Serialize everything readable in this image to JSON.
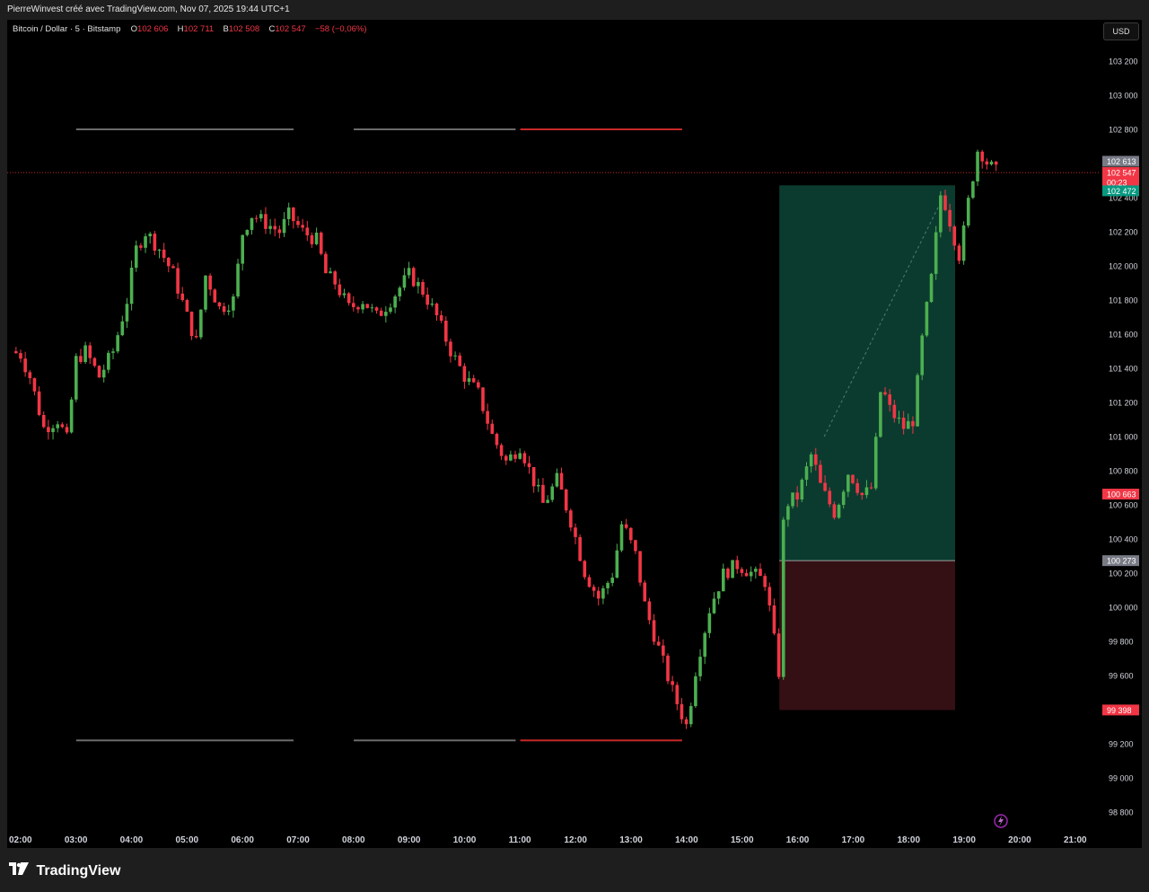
{
  "attribution": "PierreWinvest créé avec TradingView.com, Nov 07, 2025 19:44 UTC+1",
  "legend": {
    "symbol": "Bitcoin / Dollar · 5 · Bitstamp",
    "o_label": "O",
    "o_value": "102 606",
    "h_label": "H",
    "h_value": "102 711",
    "b_label": "B",
    "b_value": "102 508",
    "c_label": "C",
    "c_value": "102 547",
    "change": "−58 (−0,06%)"
  },
  "currency_button": "USD",
  "brand": "TradingView",
  "colors": {
    "up": "#26a69a",
    "up_candle": "#4caf50",
    "down": "#f23645",
    "profit_zone": "#0b3b2f",
    "loss_zone": "#341015",
    "level_gray": "#6b6b6b",
    "level_red": "#c62828",
    "background": "#000000"
  },
  "chart_data": {
    "type": "candlestick",
    "symbol": "Bitcoin / Dollar",
    "interval": "5",
    "exchange": "Bitstamp",
    "y_axis": {
      "ticks": [
        "103 200",
        "103 000",
        "102 800",
        "102 600",
        "102 400",
        "102 200",
        "102 000",
        "101 800",
        "101 600",
        "101 400",
        "101 200",
        "101 000",
        "100 800",
        "100 600",
        "100 400",
        "100 200",
        "100 000",
        "99 800",
        "99 600",
        "99 400",
        "99 200",
        "99 000",
        "98 800"
      ],
      "range": [
        98750,
        103300
      ]
    },
    "x_axis": {
      "ticks": [
        "02:00",
        "03:00",
        "04:00",
        "05:00",
        "06:00",
        "07:00",
        "08:00",
        "09:00",
        "10:00",
        "11:00",
        "12:00",
        "13:00",
        "14:00",
        "15:00",
        "16:00",
        "17:00",
        "18:00",
        "19:00",
        "20:00",
        "21:00"
      ]
    },
    "price_close_path": [
      [
        "01:50",
        101500
      ],
      [
        "02:00",
        101480
      ],
      [
        "02:10",
        101350
      ],
      [
        "02:25",
        101050
      ],
      [
        "02:40",
        101100
      ],
      [
        "02:50",
        100980
      ],
      [
        "03:00",
        101450
      ],
      [
        "03:10",
        101500
      ],
      [
        "03:25",
        101350
      ],
      [
        "03:40",
        101500
      ],
      [
        "03:55",
        101800
      ],
      [
        "04:05",
        102100
      ],
      [
        "04:15",
        102200
      ],
      [
        "04:30",
        102100
      ],
      [
        "04:45",
        101950
      ],
      [
        "05:00",
        101700
      ],
      [
        "05:10",
        101550
      ],
      [
        "05:20",
        101950
      ],
      [
        "05:35",
        101750
      ],
      [
        "05:50",
        101800
      ],
      [
        "06:00",
        102200
      ],
      [
        "06:10",
        102300
      ],
      [
        "06:25",
        102250
      ],
      [
        "06:40",
        102200
      ],
      [
        "06:50",
        102300
      ],
      [
        "07:05",
        102200
      ],
      [
        "07:20",
        102150
      ],
      [
        "07:30",
        101950
      ],
      [
        "07:40",
        101900
      ],
      [
        "07:55",
        101750
      ],
      [
        "08:10",
        101800
      ],
      [
        "08:25",
        101700
      ],
      [
        "08:40",
        101800
      ],
      [
        "09:00",
        101950
      ],
      [
        "09:15",
        101850
      ],
      [
        "09:30",
        101700
      ],
      [
        "09:45",
        101500
      ],
      [
        "10:00",
        101350
      ],
      [
        "10:15",
        101250
      ],
      [
        "10:30",
        101000
      ],
      [
        "10:45",
        100850
      ],
      [
        "11:00",
        100950
      ],
      [
        "11:10",
        100800
      ],
      [
        "11:25",
        100600
      ],
      [
        "11:40",
        100750
      ],
      [
        "11:55",
        100500
      ],
      [
        "12:10",
        100200
      ],
      [
        "12:25",
        100050
      ],
      [
        "12:40",
        100200
      ],
      [
        "12:50",
        100500
      ],
      [
        "13:05",
        100300
      ],
      [
        "13:15",
        100000
      ],
      [
        "13:30",
        99750
      ],
      [
        "13:45",
        99500
      ],
      [
        "14:00",
        99300
      ],
      [
        "14:10",
        99650
      ],
      [
        "14:25",
        100000
      ],
      [
        "14:40",
        100200
      ],
      [
        "14:55",
        100250
      ],
      [
        "15:10",
        100200
      ],
      [
        "15:25",
        100150
      ],
      [
        "15:40",
        99600
      ],
      [
        "15:45",
        100600
      ],
      [
        "16:00",
        100650
      ],
      [
        "16:15",
        100900
      ],
      [
        "16:25",
        100700
      ],
      [
        "16:40",
        100550
      ],
      [
        "16:55",
        100800
      ],
      [
        "17:10",
        100650
      ],
      [
        "17:20",
        100700
      ],
      [
        "17:30",
        101300
      ],
      [
        "17:40",
        101150
      ],
      [
        "17:55",
        101050
      ],
      [
        "18:05",
        101100
      ],
      [
        "18:15",
        101600
      ],
      [
        "18:25",
        101950
      ],
      [
        "18:35",
        102450
      ],
      [
        "18:45",
        102250
      ],
      [
        "18:55",
        102050
      ],
      [
        "19:05",
        102400
      ],
      [
        "19:15",
        102700
      ],
      [
        "19:25",
        102600
      ],
      [
        "19:35",
        102547
      ]
    ],
    "horizontal_levels": [
      {
        "price": 102800,
        "segments": [
          {
            "from": "03:00",
            "to": "06:55",
            "color": "gray"
          },
          {
            "from": "08:00",
            "to": "10:55",
            "color": "gray"
          },
          {
            "from": "11:00",
            "to": "13:55",
            "color": "red"
          }
        ]
      },
      {
        "price": 99220,
        "segments": [
          {
            "from": "03:00",
            "to": "06:55",
            "color": "gray"
          },
          {
            "from": "08:00",
            "to": "10:55",
            "color": "gray"
          },
          {
            "from": "11:00",
            "to": "13:55",
            "color": "red"
          }
        ]
      }
    ],
    "position_tool": {
      "type": "long",
      "start": "15:40",
      "end": "18:50",
      "entry": 100273,
      "target": 102472,
      "stop": 99398,
      "entry_label": "100 273",
      "target_label": "102 472",
      "stop_label": "99 398"
    },
    "price_badges": [
      {
        "label": "102 613",
        "price": 102613,
        "color": "gray"
      },
      {
        "label": "102 547",
        "price": 102547,
        "color": "red"
      },
      {
        "label": "00:23",
        "price": 102490,
        "color": "red"
      },
      {
        "label": "102 472",
        "price": 102440,
        "color": "green"
      },
      {
        "label": "100 663",
        "price": 100663,
        "color": "red"
      },
      {
        "label": "100 273",
        "price": 100273,
        "color": "gray"
      },
      {
        "label": "99 398",
        "price": 99398,
        "color": "red"
      }
    ],
    "current_price": 102547,
    "grid": false
  }
}
